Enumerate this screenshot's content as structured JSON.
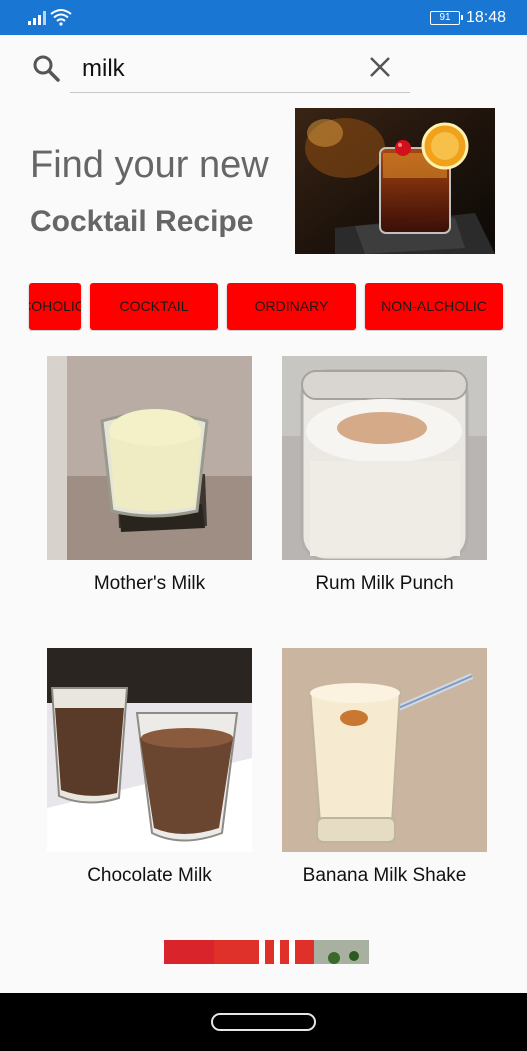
{
  "status_bar": {
    "battery": "91",
    "time": "18:48"
  },
  "search": {
    "value": "milk",
    "placeholder": ""
  },
  "hero": {
    "line1": "Find your new",
    "line2": "Cocktail Recipe"
  },
  "categories": [
    {
      "label": "ALCOHOLIC"
    },
    {
      "label": "COCKTAIL"
    },
    {
      "label": "ORDINARY"
    },
    {
      "label": "NON-ALCHOLIC"
    }
  ],
  "drinks": [
    {
      "name": "Mother's Milk"
    },
    {
      "name": "Rum Milk Punch"
    },
    {
      "name": "Chocolate Milk"
    },
    {
      "name": "Banana Milk Shake"
    }
  ],
  "colors": {
    "status_bar": "#1976d2",
    "chip_bg": "#ff0000",
    "page_bg": "#fafafa"
  }
}
